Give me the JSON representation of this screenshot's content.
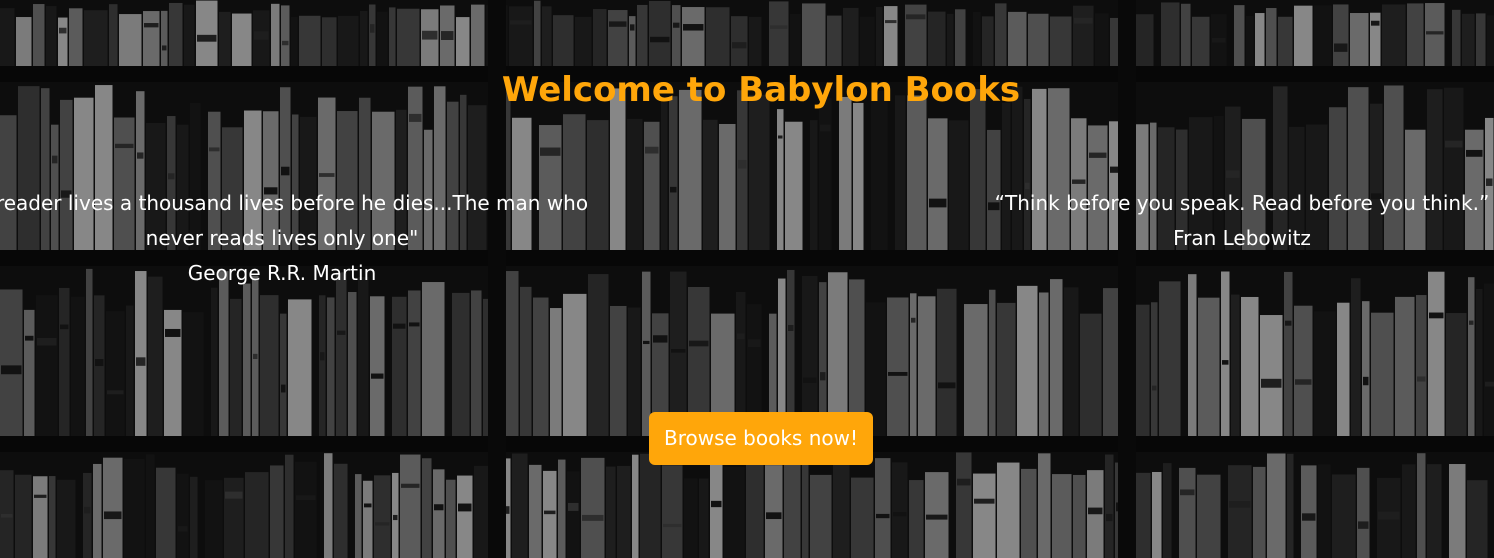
{
  "hero": {
    "title": "Welcome to Babylon Books",
    "background_image": "bookshelf-photo",
    "quotes": [
      {
        "text": "A reader lives a thousand lives before he dies...The man who never reads lives only one\"",
        "author": "George R.R. Martin"
      },
      {
        "text": "“Think before you speak. Read before you think.”",
        "author": "Fran Lebowitz"
      }
    ],
    "cta_label": "Browse books now!"
  },
  "colors": {
    "accent": "#ffa60a",
    "text": "#ffffff",
    "background": "#0d0d0d"
  }
}
